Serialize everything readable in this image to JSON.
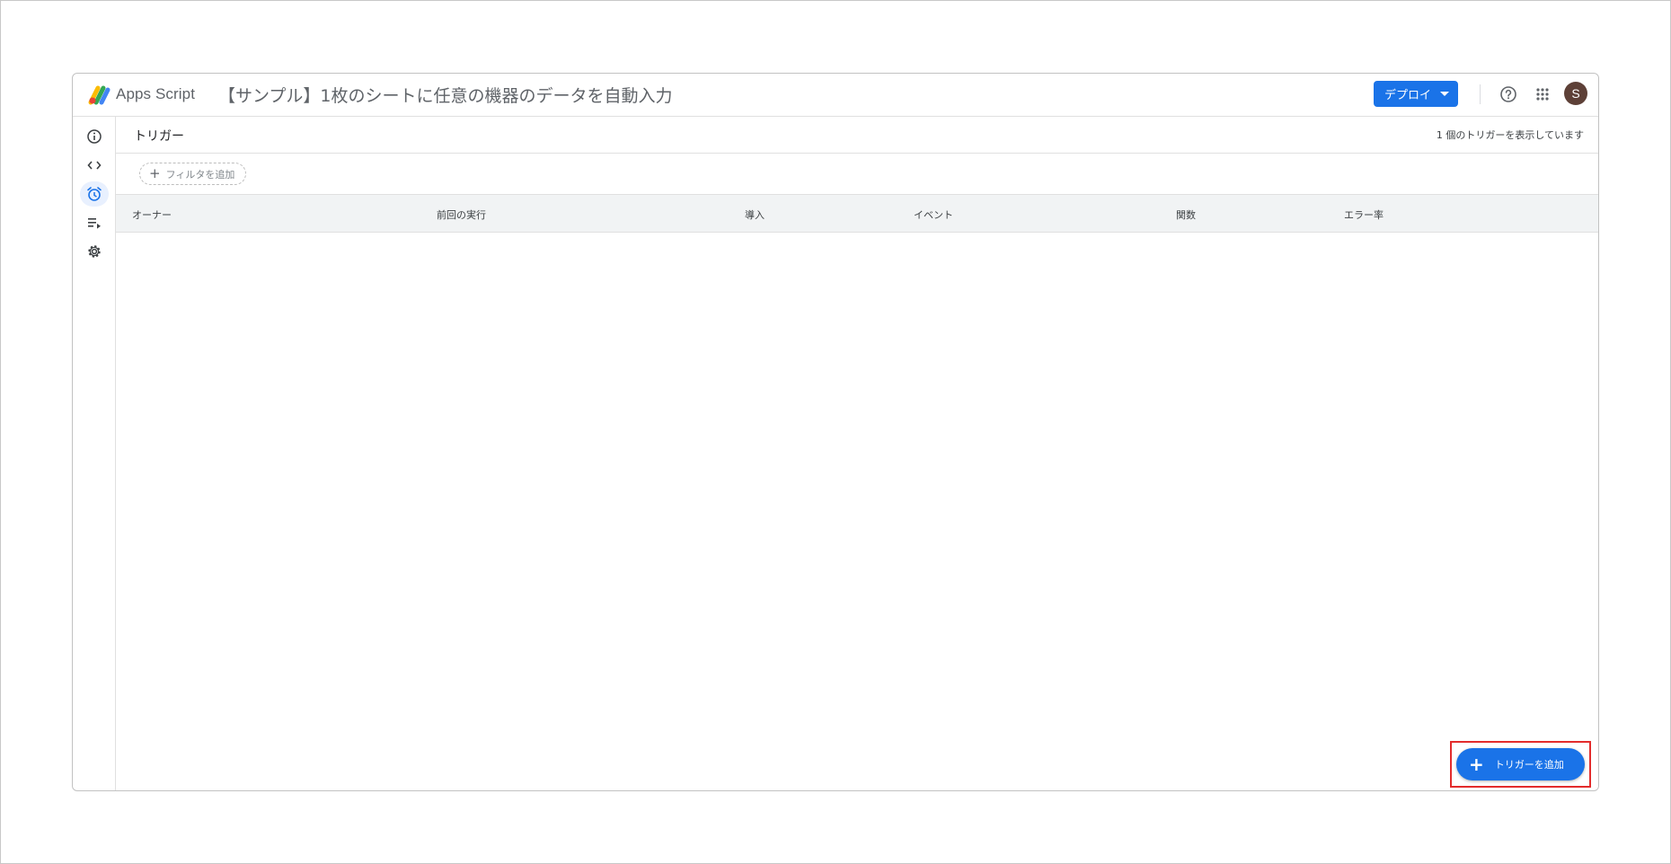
{
  "header": {
    "app_name": "Apps Script",
    "project_title": "【サンプル】1枚のシートに任意の機器のデータを自動入力",
    "deploy_label": "デプロイ",
    "avatar_initial": "S"
  },
  "sidebar": {
    "items": [
      {
        "name": "overview",
        "icon": "info-icon"
      },
      {
        "name": "editor",
        "icon": "code-icon"
      },
      {
        "name": "triggers",
        "icon": "alarm-clock-icon",
        "active": true
      },
      {
        "name": "executions",
        "icon": "executions-list-icon"
      },
      {
        "name": "settings",
        "icon": "gear-icon"
      }
    ]
  },
  "main": {
    "section_title": "トリガー",
    "count_text": "1 個のトリガーを表示しています",
    "filter_label": "フィルタを追加",
    "columns": [
      "オーナー",
      "前回の実行",
      "導入",
      "イベント",
      "関数",
      "エラー率"
    ],
    "fab_label": "トリガーを追加"
  },
  "colors": {
    "accent": "#1a73e8",
    "highlight": "#e32c2c",
    "active_nav_bg": "#e8f0fe"
  }
}
